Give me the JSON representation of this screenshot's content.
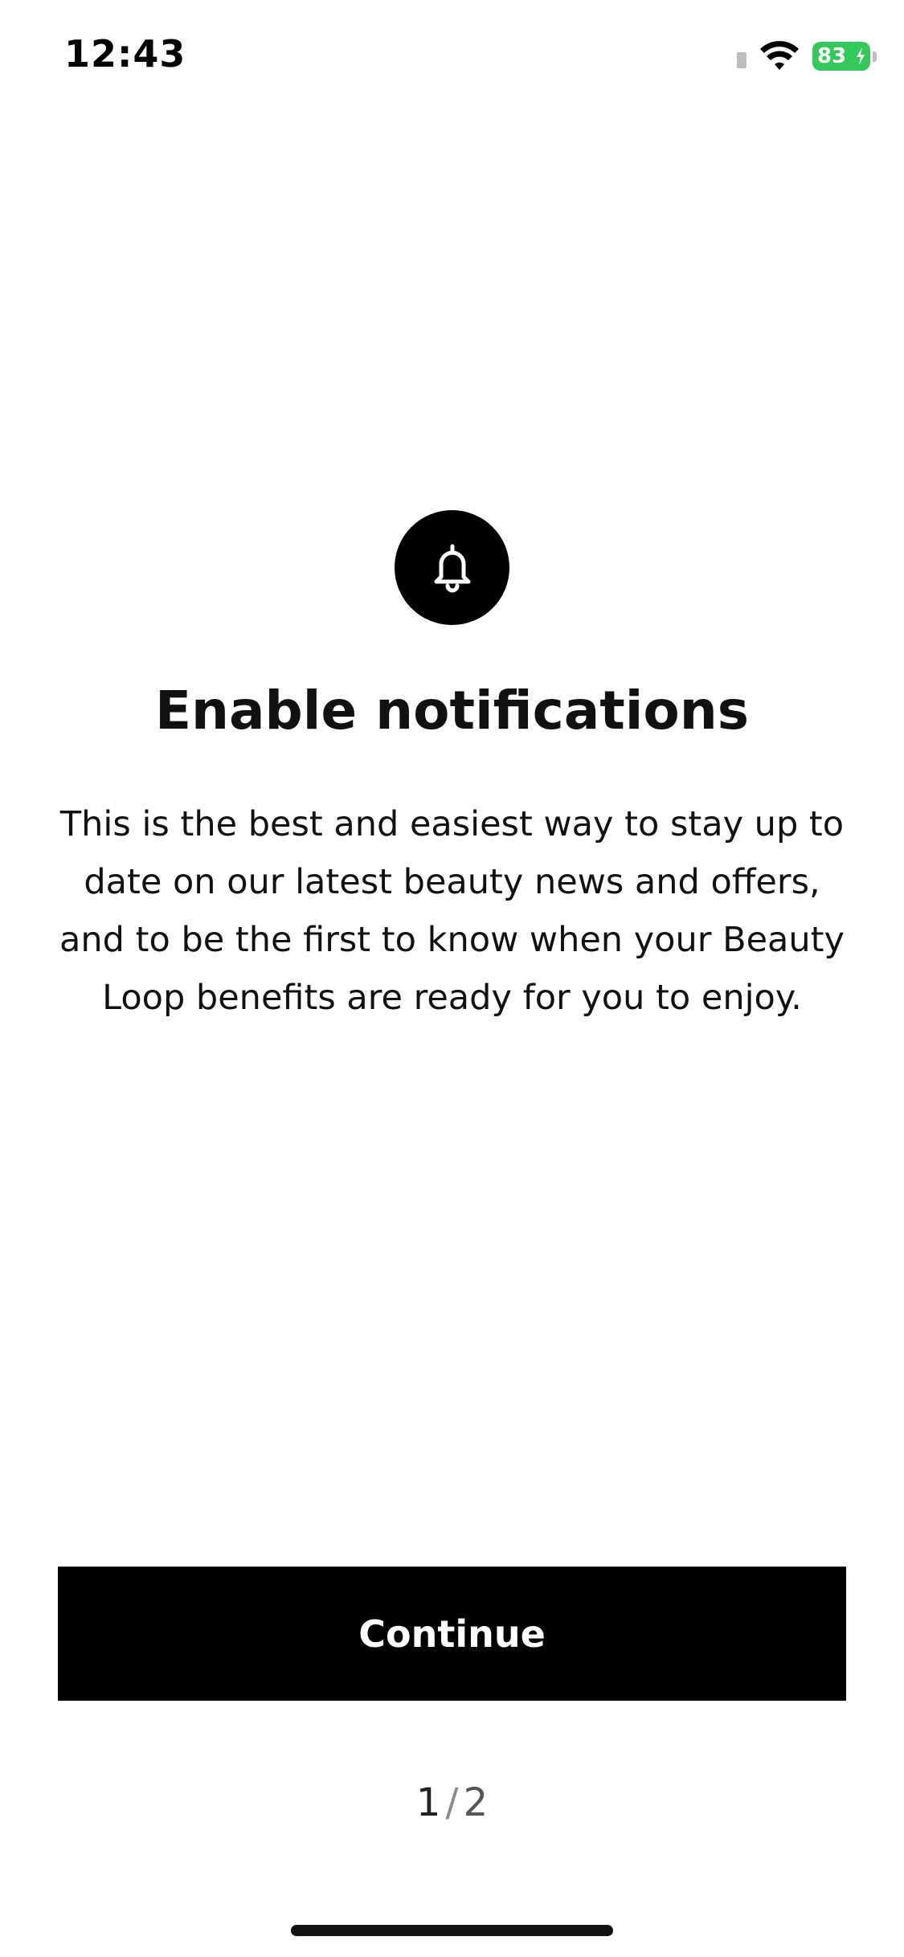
{
  "status_bar": {
    "time": "12:43",
    "battery_level": "83",
    "battery_color": "#34c759",
    "icons": [
      "signal-icon",
      "wifi-icon",
      "battery-icon",
      "charging-bolt-icon"
    ]
  },
  "onboarding": {
    "icon": "bell-icon",
    "title": "Enable notifications",
    "description": "This is the best and easiest way to stay up to date on our latest beauty news and offers, and to be the first to know when your Beauty Loop benefits are ready for you to enjoy.",
    "continue_label": "Continue",
    "pager": {
      "current": "1",
      "separator": "/",
      "total": "2"
    }
  },
  "colors": {
    "button_background": "#000000",
    "button_text": "#ffffff",
    "text": "#111111"
  }
}
